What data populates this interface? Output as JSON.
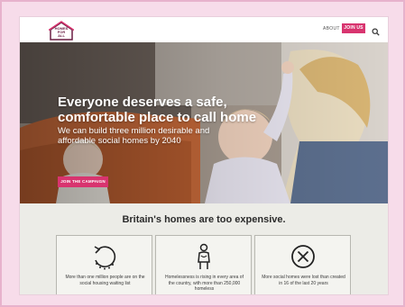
{
  "header": {
    "logo_text": "HOMES\nFOR ALL",
    "about_label": "ABOUT",
    "join_label": "JOIN US"
  },
  "hero": {
    "title": "Everyone deserves a safe, comfortable place to call home",
    "subtitle": "We can build three million desirable and affordable social homes by 2040",
    "cta_label": "JOIN THE CAMPAIGN"
  },
  "section": {
    "title": "Britain's homes are too expensive.",
    "cards": [
      {
        "icon": "waiting-circle-arrow-icon",
        "text": "More than one million people are on the social housing waiting list"
      },
      {
        "icon": "homeless-person-icon",
        "text": "Homelessness is rising in every area of the country, with more than 250,000 homeless"
      },
      {
        "icon": "x-circle-icon",
        "text": "More social homes were lost than created in 16 of the last 20 years"
      }
    ]
  },
  "colors": {
    "accent": "#d8346f",
    "background_frame": "#f7dcea",
    "section_background": "#ecece7"
  }
}
